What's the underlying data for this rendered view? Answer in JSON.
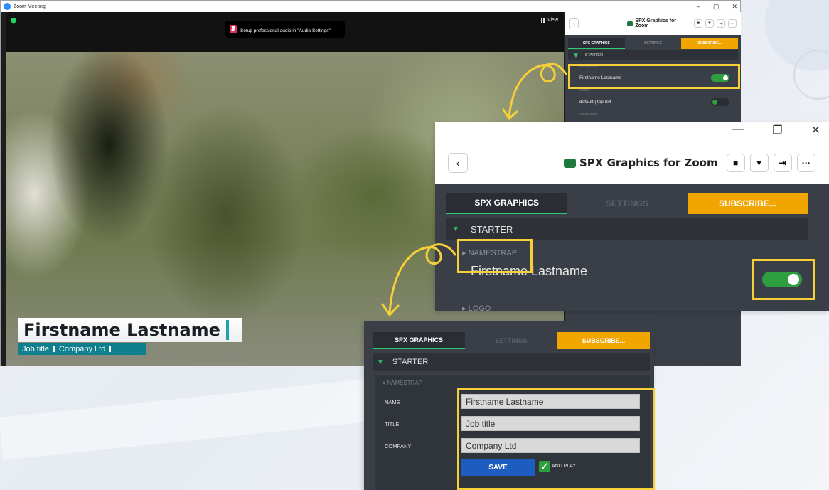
{
  "colors": {
    "accent_yellow": "#f7d038",
    "toggle_green": "#2e9e3e",
    "subscribe_orange": "#f0a500",
    "save_blue": "#1d5dbf",
    "namestrap_teal": "#0d7f8f"
  },
  "zoom": {
    "window_title": "Zoom Meeting",
    "view_label": "View",
    "audio_tip_text": "Setup professional audio in ",
    "audio_tip_link": "\"Audio Settings\"",
    "namestrap": {
      "name": "Firstname Lastname",
      "title": "Job title",
      "company": "Company Ltd"
    }
  },
  "sidebar": {
    "title": "SPX Graphics for Zoom",
    "back_icon": "chevron-left-icon",
    "tabs": [
      "SPX GRAPHICS",
      "SETTINGS",
      "SUBSCRIBE..."
    ],
    "section": "STARTER",
    "categories": {
      "namestrap": "NAMESTRAP",
      "logo": "LOGO",
      "headlines": "HEADLINES"
    },
    "rows": {
      "namestrap_item": "Firstname Lastname",
      "logo_item": "default | top-left"
    }
  },
  "form": {
    "labels": {
      "name": "NAME",
      "title": "TITLE",
      "company": "COMPANY"
    },
    "values": {
      "name": "Firstname Lastname",
      "title": "Job title",
      "company": "Company Ltd"
    },
    "save_label": "SAVE",
    "and_play_label": "AND PLAY"
  }
}
